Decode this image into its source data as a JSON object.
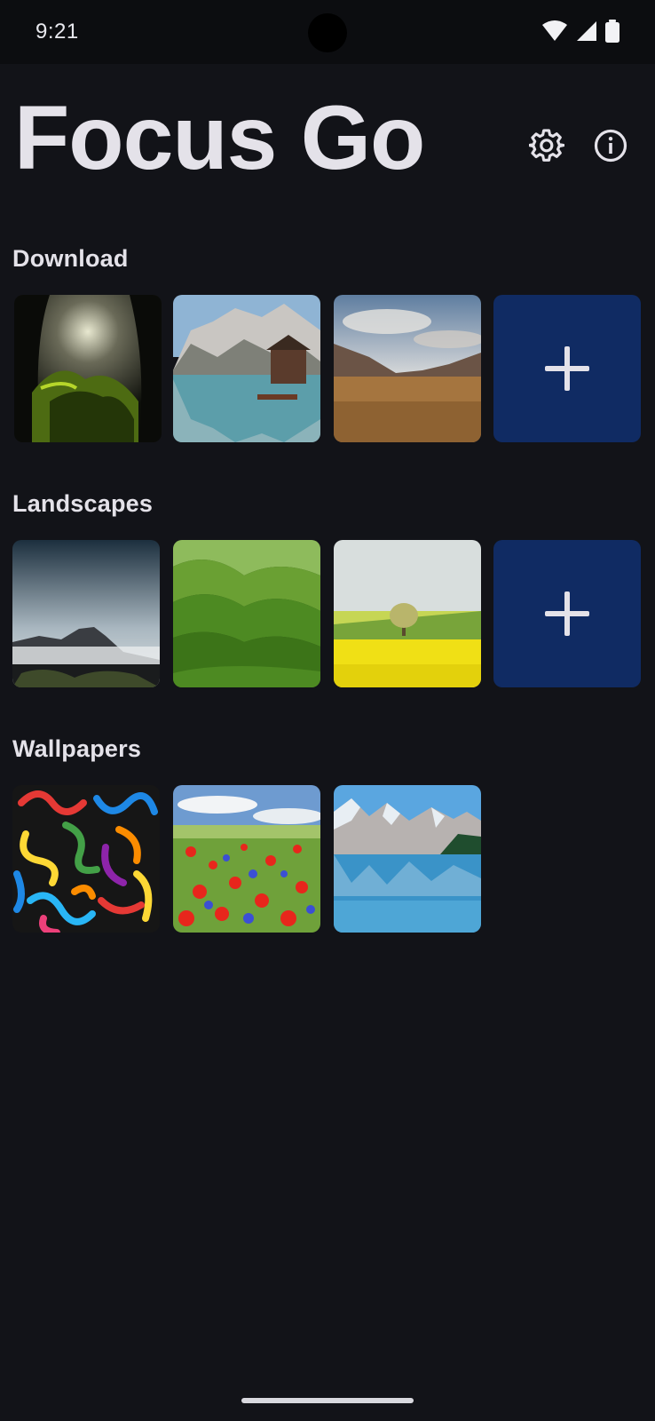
{
  "status_bar": {
    "time": "9:21",
    "icons": [
      "wifi-icon",
      "cell-signal-icon",
      "battery-icon"
    ]
  },
  "app": {
    "title": "Focus Go",
    "actions": [
      "gear-icon",
      "info-icon"
    ]
  },
  "sections": [
    {
      "title": "Download",
      "images": [
        "cave-light-rays",
        "alpine-lake-boathouse",
        "golden-field-mountains"
      ],
      "has_add_tile": true
    },
    {
      "title": "Landscapes",
      "images": [
        "misty-mountain-peak",
        "green-rolling-hills",
        "yellow-field-lone-tree"
      ],
      "has_add_tile": true
    },
    {
      "title": "Wallpapers",
      "images": [
        "colorful-squiggle-pattern",
        "poppy-flower-meadow",
        "mountain-lake-reflection"
      ],
      "has_add_tile": false
    }
  ],
  "colors": {
    "background": "#121318",
    "add_tile": "#102b63",
    "text": "#e4e2e9"
  }
}
